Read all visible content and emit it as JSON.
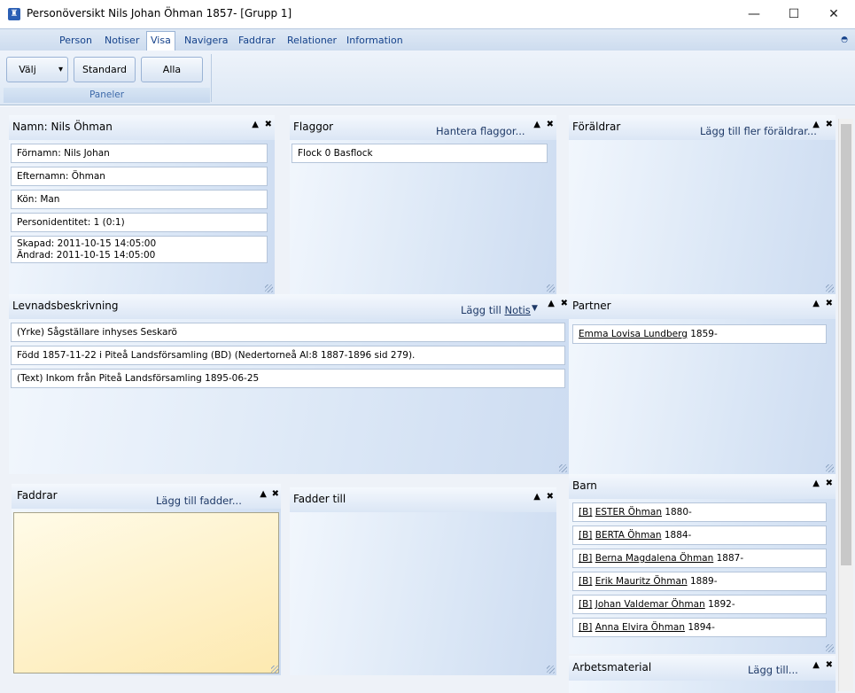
{
  "window": {
    "title": "Personöversikt Nils Johan Öhman 1857- [Grupp 1]",
    "minimize": "—",
    "maximize": "☐",
    "close": "✕"
  },
  "ribbon": {
    "tabs": [
      "Person",
      "Notiser",
      "Visa",
      "Navigera",
      "Faddrar",
      "Relationer",
      "Information"
    ],
    "active_tab": "Visa",
    "buttons": {
      "valj": "Välj",
      "valj_arrow": "▾",
      "standard": "Standard",
      "alla": "Alla"
    },
    "group_label": "Paneler"
  },
  "controls": {
    "up": "▲",
    "close": "✖",
    "dropdown": "▼"
  },
  "panels": {
    "namn": {
      "title": "Namn: Nils Öhman",
      "fields": [
        "Förnamn: Nils Johan",
        "Efternamn: Öhman",
        "Kön: Man",
        "Personidentitet: 1 (0:1)"
      ],
      "created": "Skapad: 2011-10-15 14:05:00",
      "changed": "Ändrad: 2011-10-15 14:05:00"
    },
    "flaggor": {
      "title": "Flaggor",
      "link": "Hantera flaggor...",
      "items": [
        "Flock 0 Basflock"
      ]
    },
    "foraldrar": {
      "title": "Föräldrar",
      "link": "Lägg till fler föräldrar..."
    },
    "levnad": {
      "title": "Levnadsbeskrivning",
      "link_prefix": "Lägg till ",
      "link_word": "Notis",
      "items": [
        "(Yrke) Sågställare inhyses Seskarö",
        "Född 1857-11-22 i Piteå Landsförsamling (BD) (Nedertorneå AI:8 1887-1896 sid 279).",
        "(Text) Inkom från Piteå Landsförsamling 1895-06-25"
      ]
    },
    "partner": {
      "title": "Partner",
      "items": [
        {
          "name": "Emma Lovisa Lundberg",
          "year": "1859-"
        }
      ]
    },
    "barn": {
      "title": "Barn",
      "tag": "[B]",
      "items": [
        {
          "name": "ESTER Öhman",
          "year": "1880-"
        },
        {
          "name": "BERTA Öhman",
          "year": "1884-"
        },
        {
          "name": "Berna Magdalena Öhman",
          "year": "1887-"
        },
        {
          "name": "Erik Mauritz Öhman",
          "year": "1889-"
        },
        {
          "name": "Johan Valdemar Öhman",
          "year": "1892-"
        },
        {
          "name": "Anna Elvira Öhman",
          "year": "1894-"
        }
      ]
    },
    "faddrar": {
      "title": "Faddrar",
      "link": "Lägg till fadder..."
    },
    "fadder_till": {
      "title": "Fadder till"
    },
    "arbetsmaterial": {
      "title": "Arbetsmaterial",
      "link": "Lägg till..."
    }
  }
}
